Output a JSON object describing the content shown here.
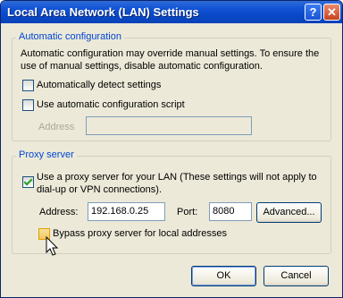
{
  "window": {
    "title": "Local Area Network (LAN) Settings",
    "help_glyph": "?",
    "close_glyph": "✕"
  },
  "auto_config": {
    "legend": "Automatic configuration",
    "description_line1": "Automatic configuration may override manual settings.  To ensure the",
    "description_line2": "use of manual settings, disable automatic configuration.",
    "detect_label": "Automatically detect settings",
    "detect_checked": false,
    "script_label": "Use automatic configuration script",
    "script_checked": false,
    "address_label": "Address",
    "address_value": ""
  },
  "proxy": {
    "legend": "Proxy server",
    "use_proxy_line1": "Use a proxy server for your LAN (These settings will not apply to",
    "use_proxy_line2": "dial-up or VPN connections).",
    "use_proxy_checked": true,
    "address_label": "Address:",
    "address_value": "192.168.0.25",
    "port_label": "Port:",
    "port_value": "8080",
    "advanced_label": "Advanced...",
    "bypass_label": "Bypass proxy server for local addresses",
    "bypass_checked": false
  },
  "buttons": {
    "ok": "OK",
    "cancel": "Cancel"
  },
  "colors": {
    "titlebar": "#0a49c9",
    "legend_text": "#0046d5",
    "dialog_bg": "#ece9d8"
  }
}
